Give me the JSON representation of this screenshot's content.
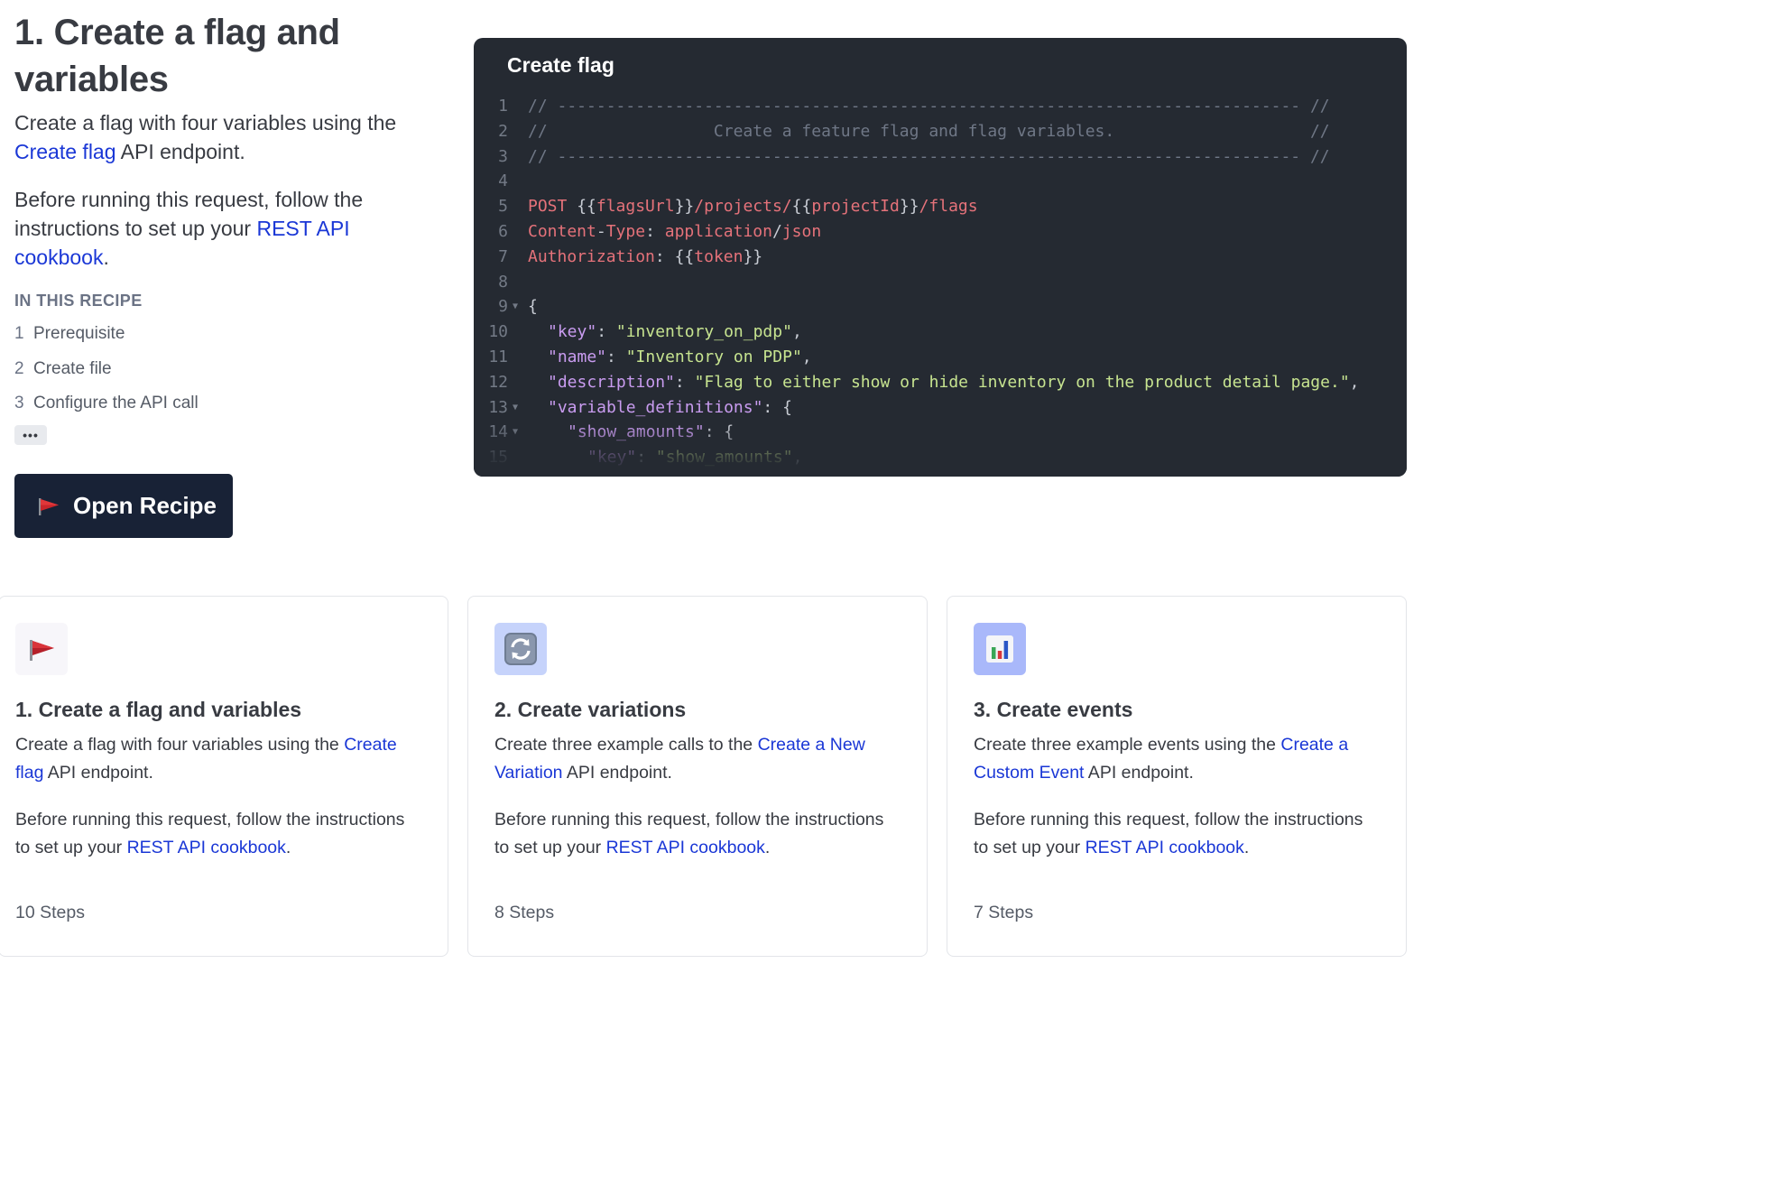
{
  "intro": {
    "title_line1": "1. Create a flag and",
    "title_line2": "variables",
    "desc1_pre": "Create a flag with four variables using the ",
    "desc1_link": "Create flag",
    "desc1_post": " API endpoint.",
    "desc2_pre": "Before running this request, follow the instructions to set up your ",
    "desc2_link": "REST API cookbook",
    "desc2_post": ".",
    "toc_heading": "IN THIS RECIPE",
    "toc": [
      {
        "num": "1",
        "label": "Prerequisite"
      },
      {
        "num": "2",
        "label": "Create file"
      },
      {
        "num": "3",
        "label": "Configure the API call"
      }
    ],
    "more_label": "•••",
    "open_button_label": "Open Recipe",
    "open_button_icon": "red-flag-icon"
  },
  "code": {
    "title": "Create flag",
    "line_numbers": [
      "1",
      "2",
      "3",
      "4",
      "5",
      "6",
      "7",
      "8",
      "9",
      "10",
      "11",
      "12",
      "13",
      "14",
      "15"
    ],
    "line1": "// ---------------------------------------------------------------------------- //",
    "line2": "//                 Create a feature flag and flag variables.                    //",
    "line3": "// ---------------------------------------------------------------------------- //",
    "line5": {
      "method": "POST",
      "open1": " {{",
      "var1": "flagsUrl",
      "close1": "}}",
      "path": "/projects/",
      "open2": "{{",
      "var2": "projectId",
      "close2": "}}",
      "tail": "/flags"
    },
    "line6": {
      "key": "Content",
      "dash": "-",
      "key2": "Type",
      "colon": ": ",
      "val1": "application",
      "slash": "/",
      "val2": "json"
    },
    "line7": {
      "key": "Authorization",
      "colon": ": ",
      "open": "{{",
      "var": "token",
      "close": "}}"
    },
    "line9": "{",
    "line10": {
      "key": "\"key\"",
      "sep": ": ",
      "val": "\"inventory_on_pdp\"",
      "end": ","
    },
    "line11": {
      "key": "\"name\"",
      "sep": ": ",
      "val": "\"Inventory on PDP\"",
      "end": ","
    },
    "line12": {
      "key": "\"description\"",
      "sep": ": ",
      "val": "\"Flag to either show or hide inventory on the product detail page.\"",
      "end": ","
    },
    "line13": {
      "key": "\"variable_definitions\"",
      "sep": ": ",
      "end": "{"
    },
    "line14": {
      "key": "\"show_amounts\"",
      "sep": ": ",
      "end": "{"
    },
    "line15": {
      "key": "\"key\"",
      "sep": ": ",
      "val": "\"show_amounts\"",
      "end": ","
    }
  },
  "cards": [
    {
      "icon": "red-flag-icon",
      "title": "1. Create a flag and variables",
      "desc_pre": "Create a flag with four variables using the ",
      "desc_link": "Create flag",
      "desc_post": " API endpoint.",
      "note_pre": "Before running this request, follow the instructions to set up your ",
      "note_link": "REST API cookbook",
      "note_post": ".",
      "steps": "10 Steps"
    },
    {
      "icon": "refresh-arrows-icon",
      "title": "2. Create variations",
      "desc_pre": "Create three example calls to the ",
      "desc_link": "Create a New Variation",
      "desc_post": " API endpoint.",
      "note_pre": "Before running this request, follow the instructions to set up your ",
      "note_link": "REST API cookbook",
      "note_post": ".",
      "steps": "8 Steps"
    },
    {
      "icon": "bar-chart-icon",
      "title": "3. Create events",
      "desc_pre": "Create three example events using the ",
      "desc_link": "Create a Custom Event",
      "desc_post": " API endpoint.",
      "note_pre": "Before running this request, follow the instructions to set up your ",
      "note_link": "REST API cookbook",
      "note_post": ".",
      "steps": "7 Steps"
    }
  ],
  "colors": {
    "link": "#1a37d6",
    "button_bg": "#182236",
    "code_bg": "#252a32",
    "code_red": "#e5727a",
    "code_key": "#c99cf0",
    "code_string": "#c7e490"
  }
}
